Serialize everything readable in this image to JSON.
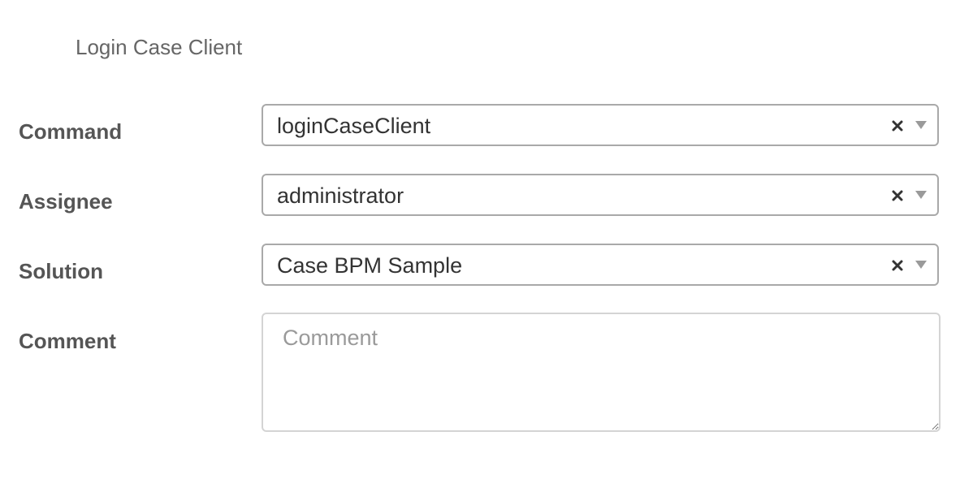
{
  "form": {
    "title": "Login Case Client"
  },
  "fields": {
    "command": {
      "label": "Command",
      "value": "loginCaseClient"
    },
    "assignee": {
      "label": "Assignee",
      "value": "administrator"
    },
    "solution": {
      "label": "Solution",
      "value": "Case BPM Sample"
    },
    "comment": {
      "label": "Comment",
      "placeholder": "Comment",
      "value": ""
    }
  },
  "icons": {
    "clear": "clear-x-icon",
    "dropdown": "chevron-down-icon",
    "resize": "resize-grip-icon"
  }
}
